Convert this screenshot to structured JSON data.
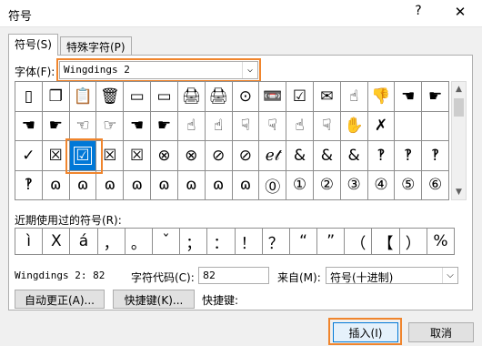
{
  "window": {
    "title": "符号",
    "help_label": "?",
    "close_label": "✕"
  },
  "tabs": [
    {
      "label": "符号(S)",
      "active": true
    },
    {
      "label": "特殊字符(P)",
      "active": false
    }
  ],
  "font": {
    "label": "字体(F):",
    "value": "Wingdings 2"
  },
  "symbol_grid": {
    "rows": [
      [
        "▯",
        "❐",
        "📋",
        "🗑",
        "▭",
        "▭",
        "🖨",
        "🖨",
        "⊙",
        "📼",
        "☑",
        "✉",
        "☝",
        "👎",
        "☚",
        "☛"
      ],
      [
        "☚",
        "☛",
        "☜",
        "☞",
        "☚",
        "☛",
        "☝",
        "☝",
        "☟",
        "☟",
        "☝",
        "☟",
        "✋",
        "✗",
        "",
        ""
      ],
      [
        "✓",
        "☒",
        "☑",
        "☒",
        "☒",
        "⊗",
        "⊗",
        "⊘",
        "⊘",
        "ℯ𝓉",
        "&",
        "&",
        "&",
        "‽",
        "‽",
        "‽"
      ],
      [
        "‽",
        "ɷ",
        "ɷ",
        "ɷ",
        "ɷ",
        "ɷ",
        "ɷ",
        "ɷ",
        "ɷ",
        "⓪",
        "①",
        "②",
        "③",
        "④",
        "⑤",
        "⑥"
      ]
    ],
    "selected": {
      "row": 2,
      "col": 2
    }
  },
  "recent": {
    "label": "近期使用过的符号(R):",
    "symbols": [
      "ì",
      "X",
      "á",
      "，",
      "。",
      "ˇ",
      "；",
      "：",
      "！",
      "？",
      "“",
      "”",
      "（",
      "【",
      "）",
      "%"
    ]
  },
  "selected_font_code": "Wingdings 2: 82",
  "char_code": {
    "label": "字符代码(C):",
    "value": "82"
  },
  "from": {
    "label": "来自(M):",
    "value": "符号(十进制)"
  },
  "buttons": {
    "autocorrect": "自动更正(A)...",
    "shortcut": "快捷键(K)...",
    "shortcut_label": "快捷键:",
    "insert": "插入(I)",
    "cancel": "取消"
  },
  "highlight_color": "#f0852d",
  "selection_color": "#0078d7"
}
